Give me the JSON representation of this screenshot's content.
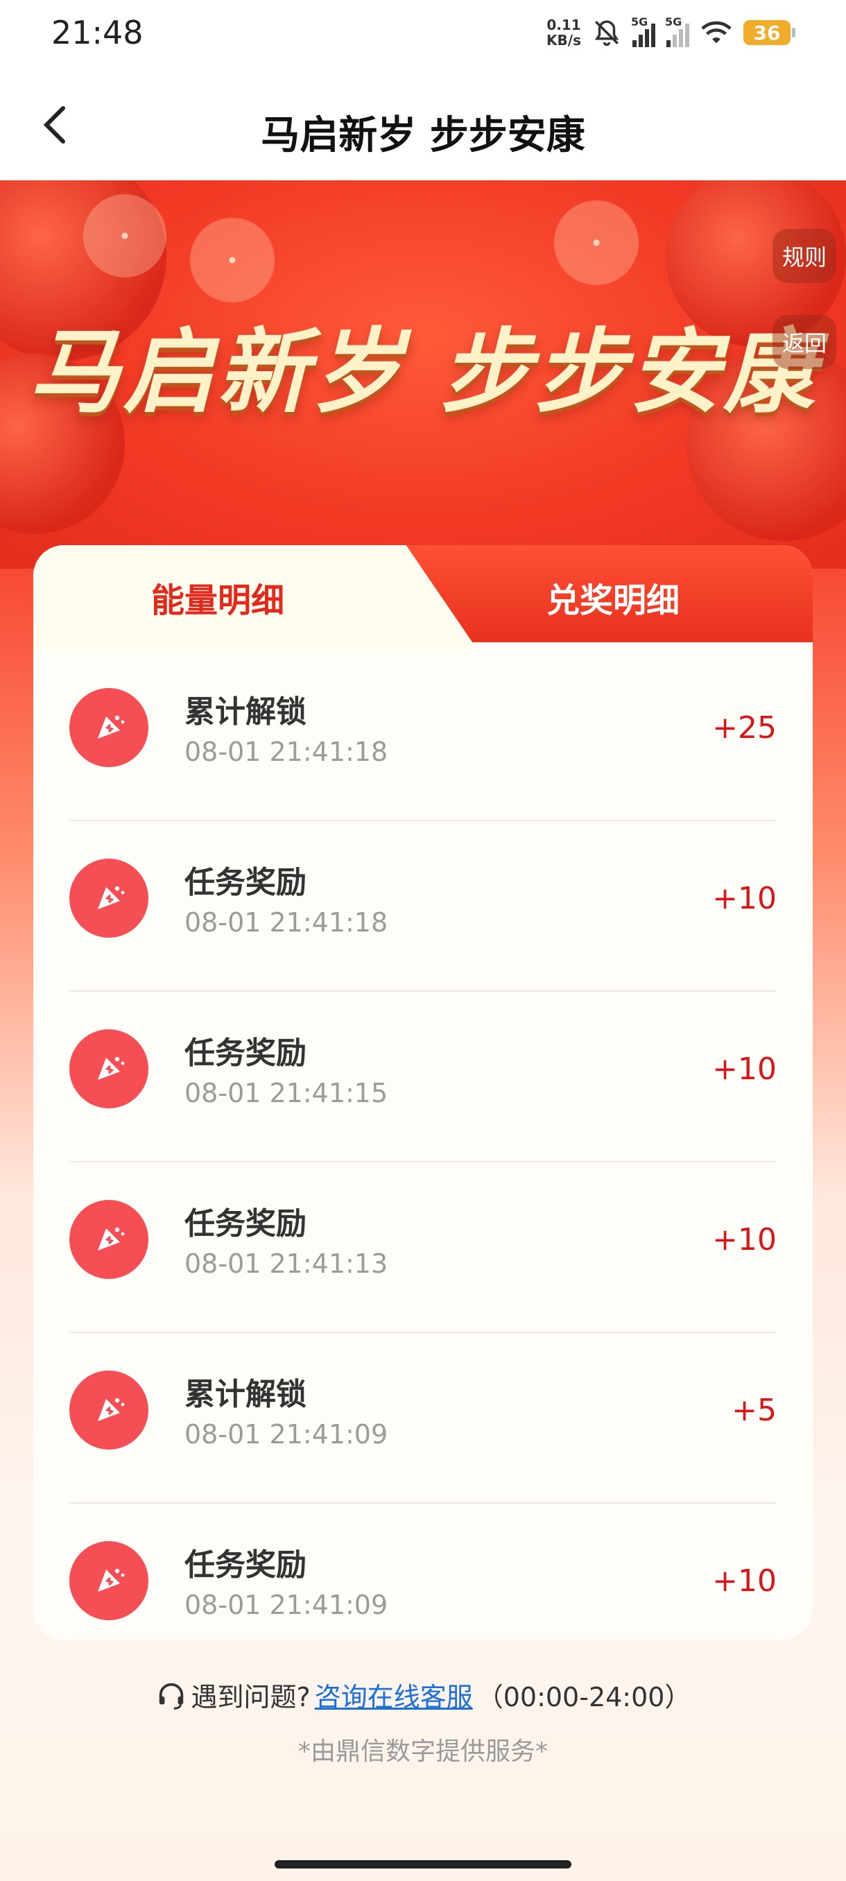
{
  "status_bar": {
    "time": "21:48",
    "net_speed_value": "0.11",
    "net_speed_unit": "KB/s",
    "signal1_label": "5G",
    "signal2_label": "5G",
    "battery": "36",
    "icons": [
      "mute-bell-icon",
      "signal-icon",
      "signal-icon",
      "wifi-icon",
      "battery-icon"
    ]
  },
  "header": {
    "title": "马启新岁 步步安康",
    "back_icon": "chevron-left-icon"
  },
  "banner": {
    "title": "马启新岁 步步安康",
    "rules_label": "规则",
    "return_label": "返回"
  },
  "tabs": {
    "energy_label": "能量明细",
    "redeem_label": "兑奖明细",
    "active": "energy"
  },
  "records": [
    {
      "title": "累计解锁",
      "time": "08-01 21:41:18",
      "value": "+25"
    },
    {
      "title": "任务奖励",
      "time": "08-01 21:41:18",
      "value": "+10"
    },
    {
      "title": "任务奖励",
      "time": "08-01 21:41:15",
      "value": "+10"
    },
    {
      "title": "任务奖励",
      "time": "08-01 21:41:13",
      "value": "+10"
    },
    {
      "title": "累计解锁",
      "time": "08-01 21:41:09",
      "value": "+5"
    },
    {
      "title": "任务奖励",
      "time": "08-01 21:41:09",
      "value": "+10"
    }
  ],
  "footer": {
    "help_text": "遇到问题?",
    "consult_link": "咨询在线客服",
    "hours": "（00:00-24:00）",
    "service_note": "*由鼎信数字提供服务*"
  },
  "colors": {
    "accent_red": "#e3281c",
    "value_red": "#d8161a",
    "link_blue": "#1b6fd9",
    "icon_bg": "#f54e55"
  }
}
